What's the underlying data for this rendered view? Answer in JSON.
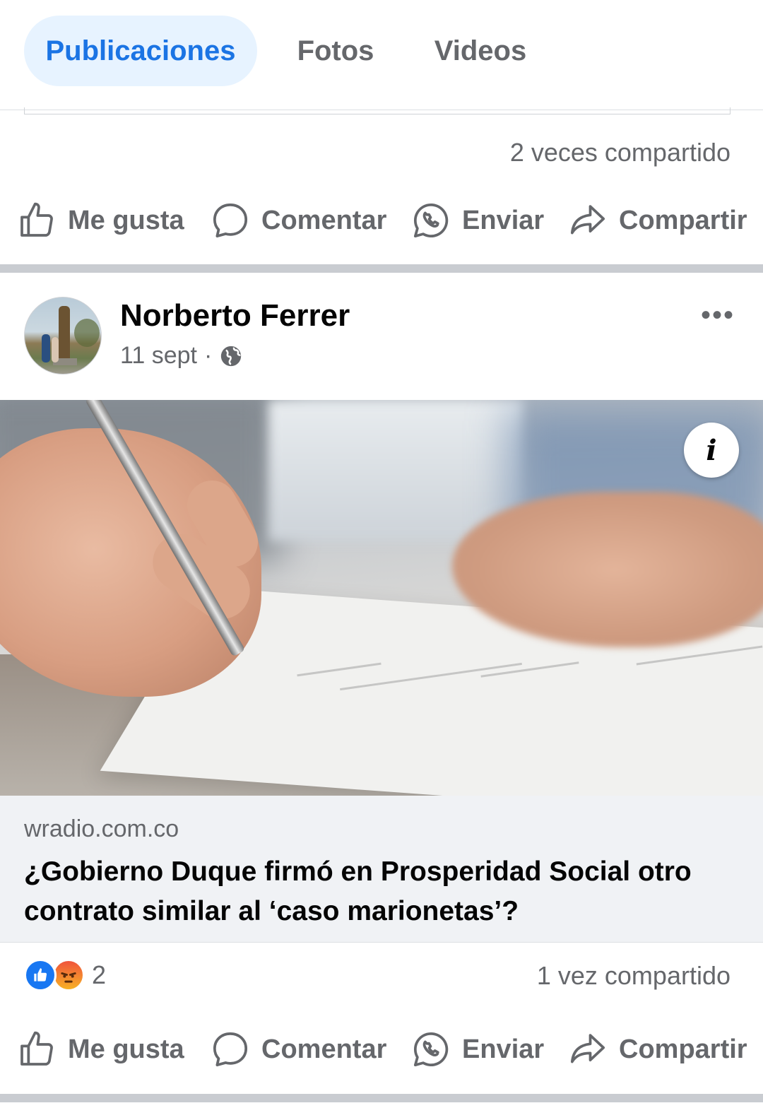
{
  "tabs": [
    {
      "label": "Publicaciones",
      "active": true
    },
    {
      "label": "Fotos",
      "active": false
    },
    {
      "label": "Videos",
      "active": false
    }
  ],
  "previous_post": {
    "shares_text": "2 veces compartido",
    "actions": {
      "like": "Me gusta",
      "comment": "Comentar",
      "send": "Enviar",
      "share": "Compartir"
    }
  },
  "post": {
    "author": "Norberto Ferrer",
    "date": "11 sept",
    "separator": "·",
    "privacy_icon": "globe-icon",
    "more_icon": "•••",
    "info_icon": "i",
    "link": {
      "domain": "wradio.com.co",
      "title": "¿Gobierno Duque firmó en Prosperidad Social otro contrato similar al ‘caso marionetas’?"
    },
    "reactions": {
      "types": [
        "like",
        "angry"
      ],
      "count": "2"
    },
    "shares_text": "1 vez compartido",
    "actions": {
      "like": "Me gusta",
      "comment": "Comentar",
      "send": "Enviar",
      "share": "Compartir"
    }
  },
  "colors": {
    "accent": "#1b74e4",
    "tab_active_bg": "#e7f3ff",
    "muted_text": "#65676b",
    "divider": "#c9ccd1"
  }
}
